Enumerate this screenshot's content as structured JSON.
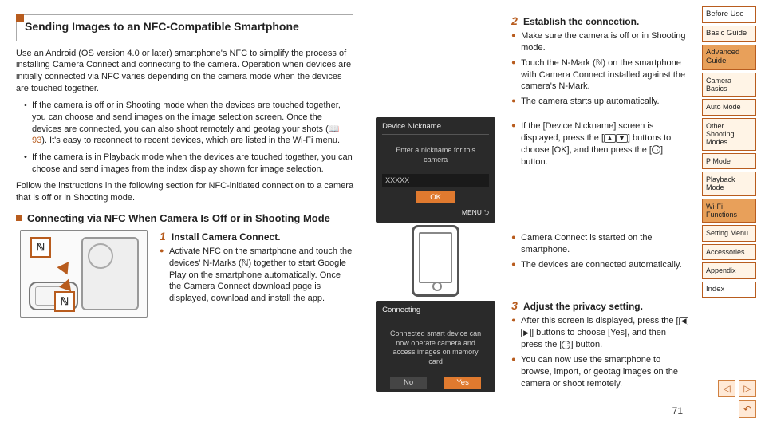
{
  "title": "Sending Images to an NFC-Compatible Smartphone",
  "intro": "Use an Android (OS version 4.0 or later) smartphone's NFC to simplify the process of installing Camera Connect and connecting to the camera. Operation when devices are initially connected via NFC varies depending on the camera mode when the devices are touched together.",
  "intro_bullets": [
    {
      "pre": "If the camera is off or in Shooting mode when the devices are touched together, you can choose and send images on the image selection screen. Once the devices are connected, you can also shoot remotely and geotag your shots (",
      "ref": "📖93",
      "post": "). It's easy to reconnect to recent devices, which are listed in the Wi-Fi menu."
    },
    {
      "full": "If the camera is in Playback mode when the devices are touched together, you can choose and send images from the index display shown for image selection."
    }
  ],
  "intro_followup": "Follow the instructions in the following section for NFC-initiated connection to a camera that is off or in Shooting mode.",
  "subheading": "Connecting via NFC When Camera Is Off or in Shooting Mode",
  "nmark_glyph": "ℕ",
  "steps": {
    "s1": {
      "num": "1",
      "title": "Install Camera Connect.",
      "items": [
        "Activate NFC on the smartphone and touch the devices' N-Marks (ℕ) together to start Google Play on the smartphone automatically. Once the Camera Connect download page is displayed, download and install the app."
      ]
    },
    "s2": {
      "num": "2",
      "title": "Establish the connection.",
      "items_a": [
        "Make sure the camera is off or in Shooting mode.",
        "Touch the N-Mark (ℕ) on the smartphone with Camera Connect installed against the camera's N-Mark.",
        "The camera starts up automatically."
      ],
      "items_b_pre": "If the [Device Nickname] screen is displayed, press the [",
      "items_b_mid": "] buttons to choose [OK], and then press the [",
      "items_b_post": "] button.",
      "items_c": [
        "Camera Connect is started on the smartphone.",
        "The devices are connected automatically."
      ]
    },
    "s3": {
      "num": "3",
      "title": "Adjust the privacy setting.",
      "item1_pre": "After this screen is displayed, press the [",
      "item1_mid": "] buttons to choose [Yes], and then press the [",
      "item1_post": "] button.",
      "item2": "You can now use the smartphone to browse, import, or geotag images on the camera or shoot remotely."
    }
  },
  "screens": {
    "nick": {
      "title": "Device Nickname",
      "hint": "Enter a nickname for this camera",
      "value": "XXXXX",
      "ok": "OK",
      "menu": "MENU ⮌"
    },
    "conn": {
      "title": "Connecting",
      "hint": "Connected smart device can now operate camera and access images on memory card",
      "no": "No",
      "yes": "Yes"
    }
  },
  "nav": {
    "items": [
      {
        "label": "Before Use",
        "cls": "plain"
      },
      {
        "label": "Basic Guide",
        "cls": ""
      },
      {
        "label": "Advanced Guide",
        "cls": "active"
      },
      {
        "label": "Camera Basics",
        "cls": "sub"
      },
      {
        "label": "Auto Mode",
        "cls": "sub"
      },
      {
        "label": "Other Shooting Modes",
        "cls": "sub"
      },
      {
        "label": "P Mode",
        "cls": "sub"
      },
      {
        "label": "Playback Mode",
        "cls": "sub"
      },
      {
        "label": "Wi-Fi Functions",
        "cls": "sub active"
      },
      {
        "label": "Setting Menu",
        "cls": "sub"
      },
      {
        "label": "Accessories",
        "cls": "sub"
      },
      {
        "label": "Appendix",
        "cls": "sub"
      },
      {
        "label": "Index",
        "cls": "plain"
      }
    ]
  },
  "page_number": "71",
  "controls": {
    "prev": "◁",
    "next": "▷",
    "return": "↶"
  }
}
